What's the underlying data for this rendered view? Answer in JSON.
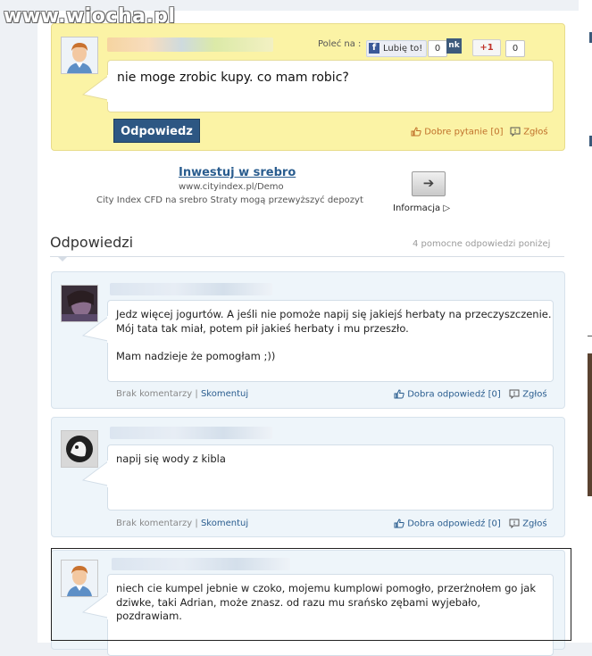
{
  "watermark": "www.wiocha.pl",
  "question": {
    "text": "nie moge zrobic kupy. co mam robic?",
    "share_label": "Poleć na :",
    "facebook_like": "Lubię to!",
    "facebook_count": "0",
    "nk_label": "nk",
    "gplus_label": "+1",
    "gplus_count": "0",
    "reply_button": "Odpowiedz",
    "good_question": "Dobre pytanie [0]",
    "report": "Zgłoś"
  },
  "ad": {
    "title": "Inwestuj w srebro",
    "url": "www.cityindex.pl/Demo",
    "description": "City Index CFD na srebro Straty mogą przewyższyć depozyt",
    "info_label": "Informacja"
  },
  "answers_section": {
    "title": "Odpowiedzi",
    "helpful_count": "4 pomocne odpowiedzi poniżej"
  },
  "answers": [
    {
      "text": "Jedz więcej jogurtów. A jeśli nie pomoże napij się jakiejś herbaty na przeczyszczenie.\nMój tata tak miał, potem pił jakieś herbaty i mu przeszło.\n\nMam nadzieje że pomogłam ;))",
      "no_comments": "Brak komentarzy",
      "separator": "|",
      "comment": "Skomentuj",
      "good_answer": "Dobra odpowiedź [0]",
      "report": "Zgłoś"
    },
    {
      "text": "napij się wody z kibla",
      "no_comments": "Brak komentarzy",
      "separator": "|",
      "comment": "Skomentuj",
      "good_answer": "Dobra odpowiedź [0]",
      "report": "Zgłoś"
    },
    {
      "text": "niech cie kumpel jebnie w czoko, mojemu kumplowi pomogło, przerżnołem go jak dziwke, taki Adrian, może znasz. od razu mu srańsko zębami wyjebało, pozdrawiam."
    }
  ],
  "colors": {
    "question_bg": "#fbf3a5",
    "answer_bg": "#eef5fa",
    "primary_button": "#2d5783",
    "link": "#2a5d8f",
    "question_action": "#c0702a"
  }
}
